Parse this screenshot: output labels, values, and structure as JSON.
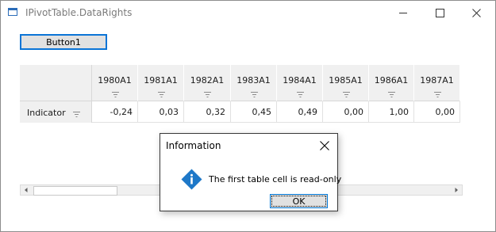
{
  "window": {
    "title": "IPivotTable.DataRights",
    "controls": [
      "minimize-icon",
      "maximize-icon",
      "close-icon"
    ]
  },
  "toolbar": {
    "button1_label": "Button1"
  },
  "grid": {
    "columns": [
      "1980A1",
      "1981A1",
      "1982A1",
      "1983A1",
      "1984A1",
      "1985A1",
      "1986A1",
      "1987A1"
    ],
    "rows": [
      {
        "label": "Indicator",
        "values": [
          "-0,24",
          "0,03",
          "0,32",
          "0,45",
          "0,49",
          "0,00",
          "1,00",
          "0,00"
        ]
      }
    ]
  },
  "dialog": {
    "title": "Information",
    "icon": "info-icon",
    "message": "The first table cell is read-only",
    "ok_label": "OK"
  },
  "colors": {
    "accent": "#0078d7",
    "info_icon": "#1e78c8",
    "header_bg": "#f0f0f0"
  }
}
